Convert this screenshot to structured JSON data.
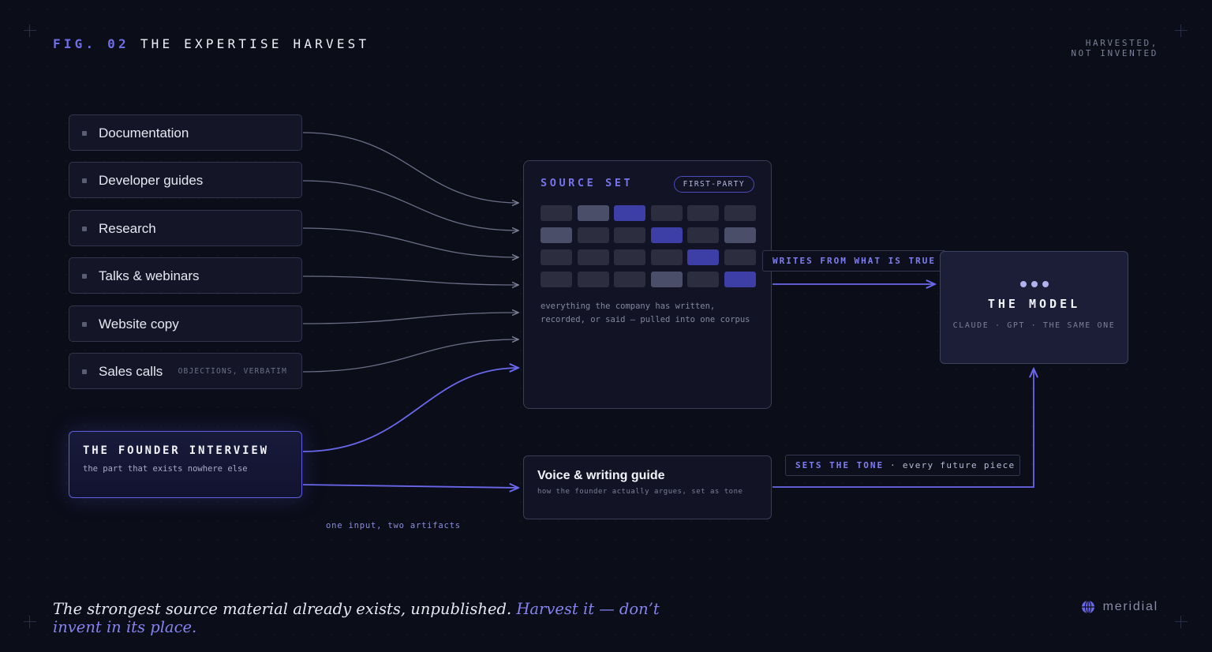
{
  "header": {
    "fig": "FIG. 02",
    "title": "THE EXPERTISE HARVEST",
    "tagline_line1": "HARVESTED,",
    "tagline_line2": "NOT INVENTED"
  },
  "sources": [
    {
      "label": "Documentation",
      "note": ""
    },
    {
      "label": "Developer guides",
      "note": ""
    },
    {
      "label": "Research",
      "note": ""
    },
    {
      "label": "Talks & webinars",
      "note": ""
    },
    {
      "label": "Website copy",
      "note": ""
    },
    {
      "label": "Sales calls",
      "note": "OBJECTIONS, VERBATIM"
    }
  ],
  "founder": {
    "title": "THE FOUNDER INTERVIEW",
    "subtitle": "the part that exists nowhere else"
  },
  "founder_caption": "one input, two artifacts",
  "source_set": {
    "title": "SOURCE SET",
    "badge": "FIRST-PARTY",
    "description": "everything the company has written, recorded, or said — pulled into one corpus"
  },
  "pill_writes": "WRITES FROM WHAT IS TRUE",
  "model": {
    "title": "THE MODEL",
    "subtitle": "CLAUDE · GPT · THE SAME ONE"
  },
  "voice": {
    "title": "Voice & writing guide",
    "subtitle": "how the founder actually argues, set as tone"
  },
  "pill_tone": {
    "emphasis": "SETS THE TONE",
    "rest": " · every future piece"
  },
  "quote": {
    "plain": "The strongest source material already exists, unpublished.",
    "highlight": "Harvest it — don’t invent in its place."
  },
  "brand": "meridial",
  "colors": {
    "background": "#0b0d19",
    "accent": "#6f6ee6",
    "wire_muted": "#6b6e86",
    "wire_accent": "#6a68ea"
  }
}
